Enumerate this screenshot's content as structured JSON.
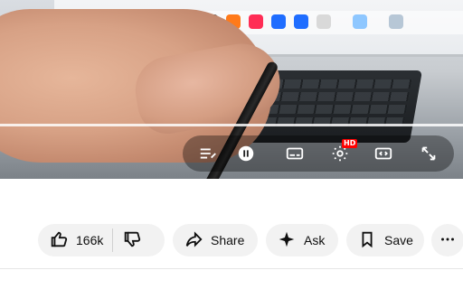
{
  "player": {
    "progress_fraction": 1.0,
    "controls": {
      "queue_icon": "playlist-icon",
      "play_pause_icon": "pause-icon",
      "captions_icon": "subtitles-icon",
      "settings_icon": "gear-icon",
      "settings_badge": "HD",
      "miniplayer_icon": "picture-in-picture-icon",
      "fullscreen_icon": "fullscreen-icon"
    }
  },
  "actions": {
    "likes": "166k",
    "share_label": "Share",
    "ask_label": "Ask",
    "save_label": "Save"
  },
  "colors": {
    "accent_red": "#ff0000",
    "pill_bg": "#f2f2f2",
    "text": "#0f0f0f"
  }
}
